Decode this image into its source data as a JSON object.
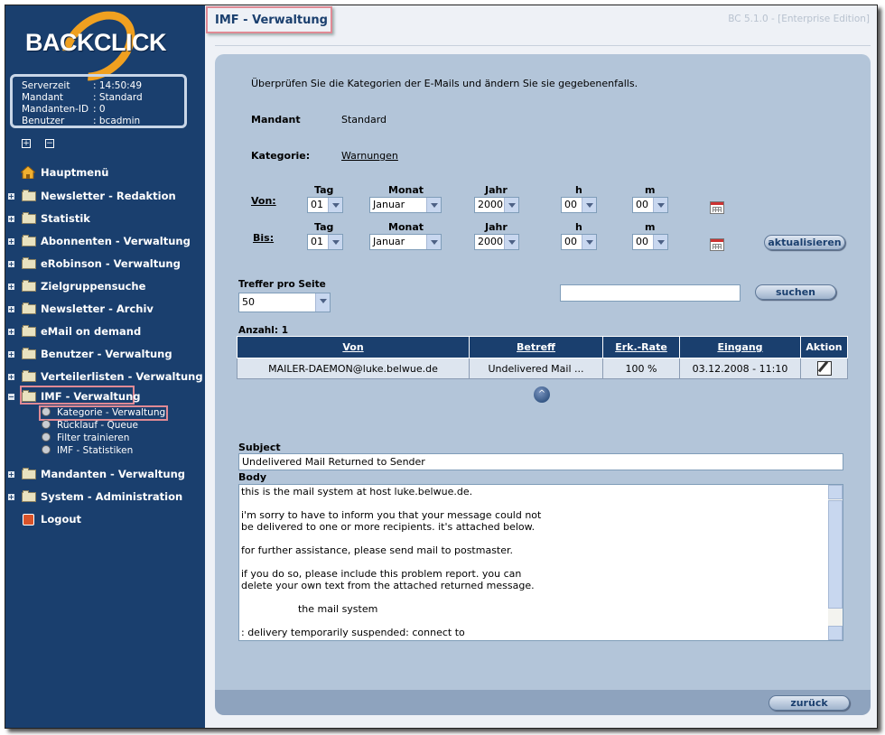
{
  "brand": {
    "logo_text": "BACKCLICK"
  },
  "info": {
    "rows": [
      {
        "key": "Serverzeit",
        "value": ": 14:50:49"
      },
      {
        "key": "Mandant",
        "value": ": Standard"
      },
      {
        "key": "Mandanten-ID",
        "value": ": 0"
      },
      {
        "key": "Benutzer",
        "value": ": bcadmin"
      }
    ]
  },
  "tree_controls": {
    "expand": "+",
    "collapse": "−"
  },
  "nav": {
    "home": "Hauptmenü",
    "items": [
      {
        "label": "Newsletter - Redaktion"
      },
      {
        "label": "Statistik"
      },
      {
        "label": "Abonnenten - Verwaltung"
      },
      {
        "label": "eRobinson - Verwaltung"
      },
      {
        "label": "Zielgruppensuche"
      },
      {
        "label": "Newsletter - Archiv"
      },
      {
        "label": "eMail on demand"
      },
      {
        "label": "Benutzer - Verwaltung"
      },
      {
        "label": "Verteilerlisten - Verwaltung"
      },
      {
        "label": "IMF - Verwaltung"
      },
      {
        "label": "Mandanten - Verwaltung"
      },
      {
        "label": "System - Administration"
      }
    ],
    "sub_items": [
      {
        "label": "Kategorie - Verwaltung"
      },
      {
        "label": "Rücklauf - Queue"
      },
      {
        "label": "Filter trainieren"
      },
      {
        "label": "IMF - Statistiken"
      }
    ],
    "logout": "Logout"
  },
  "header": {
    "title": "IMF - Verwaltung",
    "version": "BC 5.1.0 - [Enterprise Edition]"
  },
  "main": {
    "intro": "Überprüfen Sie die Kategorien der E-Mails und ändern Sie sie gegebenenfalls.",
    "mandant_label": "Mandant",
    "mandant_value": "Standard",
    "kategorie_label": "Kategorie:",
    "kategorie_value": "Warnungen",
    "date_headers": {
      "tag": "Tag",
      "monat": "Monat",
      "jahr": "Jahr",
      "h": "h",
      "m": "m"
    },
    "von": {
      "label": "Von:",
      "tag": "01",
      "monat": "Januar",
      "jahr": "2000",
      "h": "00",
      "m": "00"
    },
    "bis": {
      "label": "Bis:",
      "tag": "01",
      "monat": "Januar",
      "jahr": "2000",
      "h": "00",
      "m": "00"
    },
    "refresh_button": "aktualisieren",
    "per_page_label": "Treffer pro Seite",
    "per_page_value": "50",
    "search_value": "",
    "search_button": "suchen",
    "count_label": "Anzahl: 1",
    "table": {
      "headers": [
        "Von",
        "Betreff",
        "Erk.-Rate",
        "Eingang",
        "Aktion"
      ],
      "rows": [
        {
          "von": "MAILER-DAEMON@luke.belwue.de",
          "betreff": "Undelivered Mail ...",
          "rate": "100 %",
          "eingang": "03.12.2008 - 11:10"
        }
      ]
    },
    "up_glyph": "^",
    "subject_label": "Subject",
    "subject_value": "Undelivered Mail Returned to Sender",
    "body_label": "Body",
    "body_value": "this is the mail system at host luke.belwue.de.\n\ni'm sorry to have to inform you that your message could not\nbe delivered to one or more recipients. it's attached below.\n\nfor further assistance, please send mail to postmaster.\n\nif you do so, please include this problem report. you can\ndelete your own text from the attached returned message.\n\n                  the mail system\n\n: delivery temporarily suspended: connect to",
    "back_button": "zurück"
  }
}
